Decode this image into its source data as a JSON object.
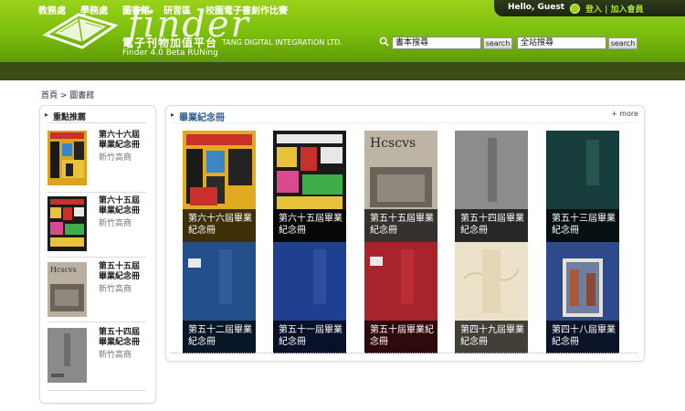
{
  "header": {
    "brand": "finder",
    "subtitle_cn": "電子刊物加值平台",
    "subtitle_en": "TANG DIGITAL INTEGRATION LTD.",
    "version": "Finder 4.0 Beta RUNing"
  },
  "userbar": {
    "greeting": "Hello, Guest",
    "login_text": "登入 | 加入會員"
  },
  "search": {
    "book_value": "書本搜尋",
    "site_value": "全站搜尋",
    "button_label": "search"
  },
  "nav": {
    "items": [
      "教務處",
      "學務處",
      "圖書館",
      "研習區",
      "校園電子書創作比賽"
    ]
  },
  "breadcrumb": "首頁 > 圖書館",
  "sidebar": {
    "title": "重點推薦",
    "items": [
      {
        "title": "第六十六屆畢業紀念冊",
        "subtitle": "新竹高商"
      },
      {
        "title": "第六十五屆畢業紀念冊",
        "subtitle": "新竹高商"
      },
      {
        "title": "第五十五屆畢業紀念冊",
        "subtitle": "新竹高商"
      },
      {
        "title": "第五十四屆畢業紀念冊",
        "subtitle": "新竹高商"
      }
    ]
  },
  "main": {
    "title": "畢業紀念冊",
    "more": "+ more",
    "books": [
      {
        "caption": "第六十六屆畢業紀念冊",
        "cover_color": "#c9302c"
      },
      {
        "caption": "第六十五屆畢業紀念冊",
        "cover_color": "#2b2b2b"
      },
      {
        "caption": "第五十五屆畢業紀念冊",
        "cover_color": "#8c8274"
      },
      {
        "caption": "第五十四屆畢業紀念冊",
        "cover_color": "#8a8a8a"
      },
      {
        "caption": "第五十三屆畢業紀念冊",
        "cover_color": "#163c3c"
      },
      {
        "caption": "第五十二屆畢業紀念冊",
        "cover_color": "#234f8a"
      },
      {
        "caption": "第五十一屆畢業紀念冊",
        "cover_color": "#1f3f90"
      },
      {
        "caption": "第五十屆畢業紀念冊",
        "cover_color": "#a8242b"
      },
      {
        "caption": "第四十九屆畢業紀念冊",
        "cover_color": "#ece2c9"
      },
      {
        "caption": "第四十八屆畢業紀念冊",
        "cover_color": "#2e4a8c"
      }
    ]
  },
  "colors": {
    "header_green": "#7bbd0c",
    "nav_dark": "#3a4d16",
    "panel_title": "#2d5a8a"
  }
}
